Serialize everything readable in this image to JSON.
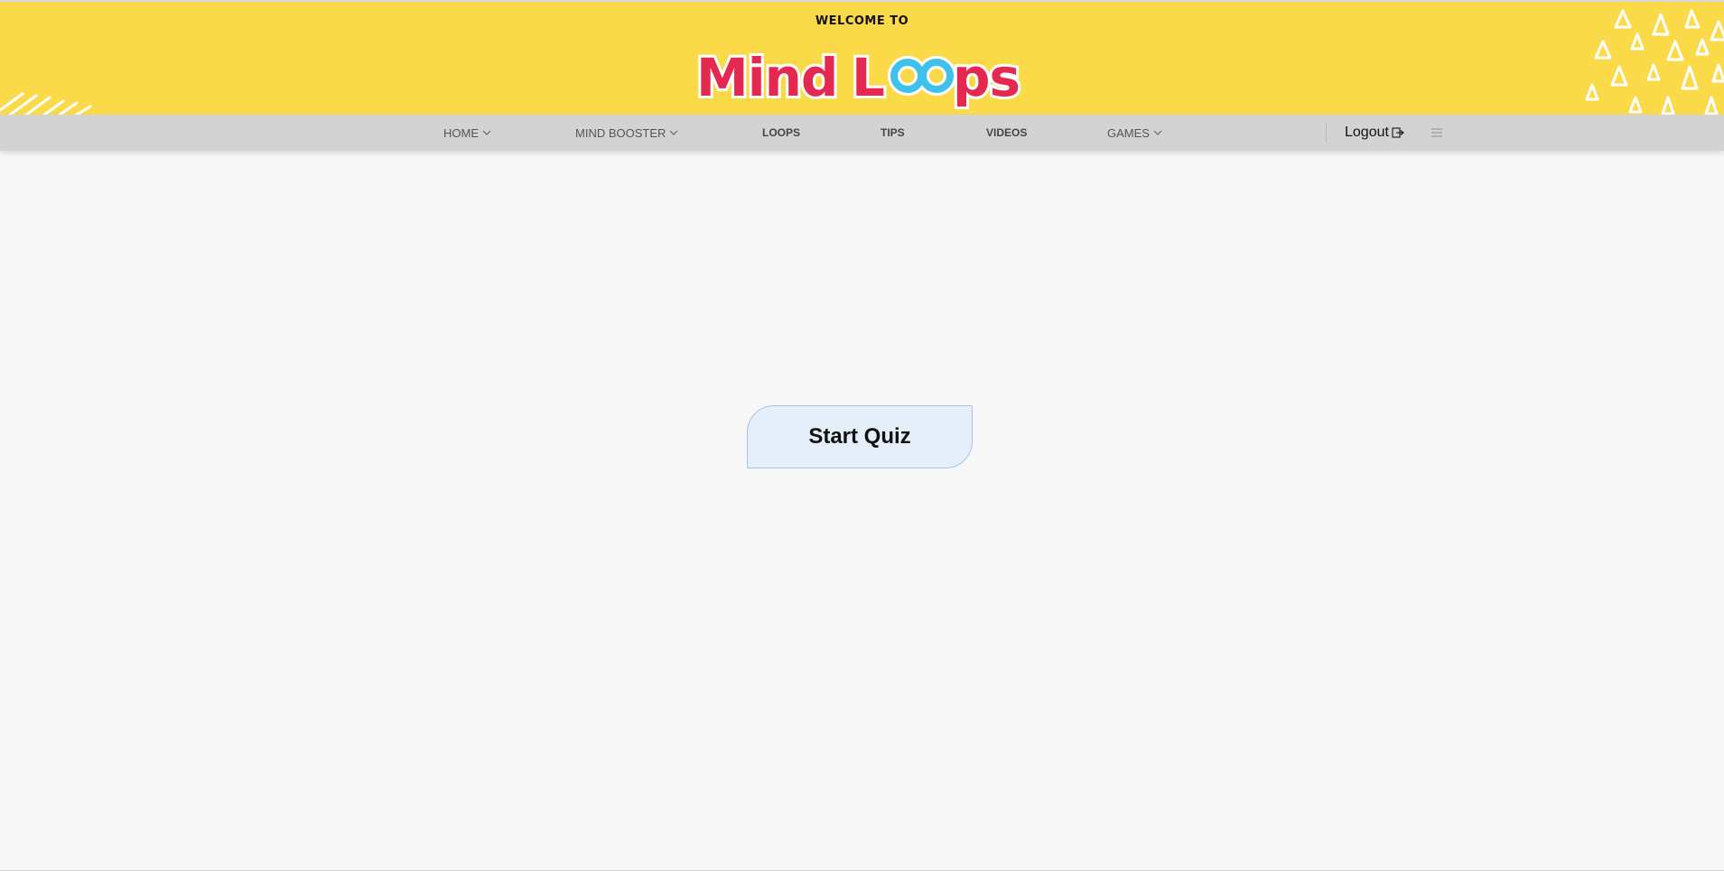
{
  "banner": {
    "welcome_text": "WELCOME TO",
    "logo_text": "MindLoops",
    "background_color": "#fbda4a"
  },
  "nav": {
    "items": [
      {
        "label": "HOME",
        "has_dropdown": true
      },
      {
        "label": "MIND BOOSTER",
        "has_dropdown": true
      },
      {
        "label": "LOOPS",
        "has_dropdown": false
      },
      {
        "label": "TIPS",
        "has_dropdown": false
      },
      {
        "label": "VIDEOS",
        "has_dropdown": false
      },
      {
        "label": "GAMES",
        "has_dropdown": true
      }
    ],
    "logout_label": "Logout",
    "logout_icon": "logout-icon",
    "menu_icon": "hamburger-icon",
    "background_color": "#d3d3d3"
  },
  "main": {
    "start_quiz_label": "Start Quiz",
    "button_background": "#e5eff9"
  },
  "colors": {
    "logo_red": "#e4284f",
    "logo_blue": "#3fc1ea",
    "page_background": "#f7f7f7"
  }
}
